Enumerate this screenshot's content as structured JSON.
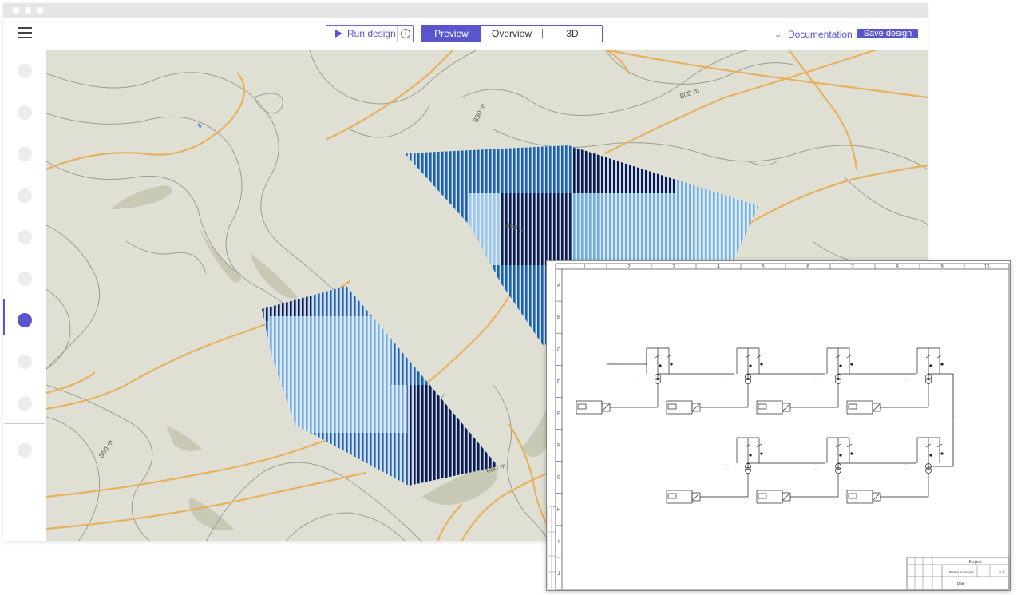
{
  "toolbar": {
    "run_design_label": "Run design",
    "info_icon": "info-icon",
    "tabs": [
      {
        "label": "Preview",
        "active": true
      },
      {
        "label": "Overview",
        "active": false
      },
      {
        "label": "3D",
        "active": false
      }
    ],
    "documentation_label": "Documentation",
    "save_label": "Save design"
  },
  "sidebar": {
    "item_count": 10,
    "active_index": 6
  },
  "map": {
    "contour_labels": [
      "800 m",
      "850 m",
      "800 m",
      "850 m",
      "850 m"
    ]
  },
  "schematic": {
    "columns": [
      "1",
      "2",
      "3",
      "4",
      "5",
      "6",
      "7",
      "8",
      "9",
      "10"
    ],
    "rows": [
      "A",
      "B",
      "C",
      "D",
      "E",
      "F",
      "G",
      "H",
      "I",
      "J"
    ],
    "title_block": {
      "project": "Project",
      "name_surname": "Name surname",
      "date": "Date"
    }
  },
  "colors": {
    "accent": "#5a55cc",
    "map_bg": "#dfdfd3",
    "road": "#e7b15f",
    "contour": "#9d9d90",
    "panel_dark": "#0d1c4a",
    "panel_mid": "#1c62ad",
    "panel_light": "#6faedf"
  }
}
